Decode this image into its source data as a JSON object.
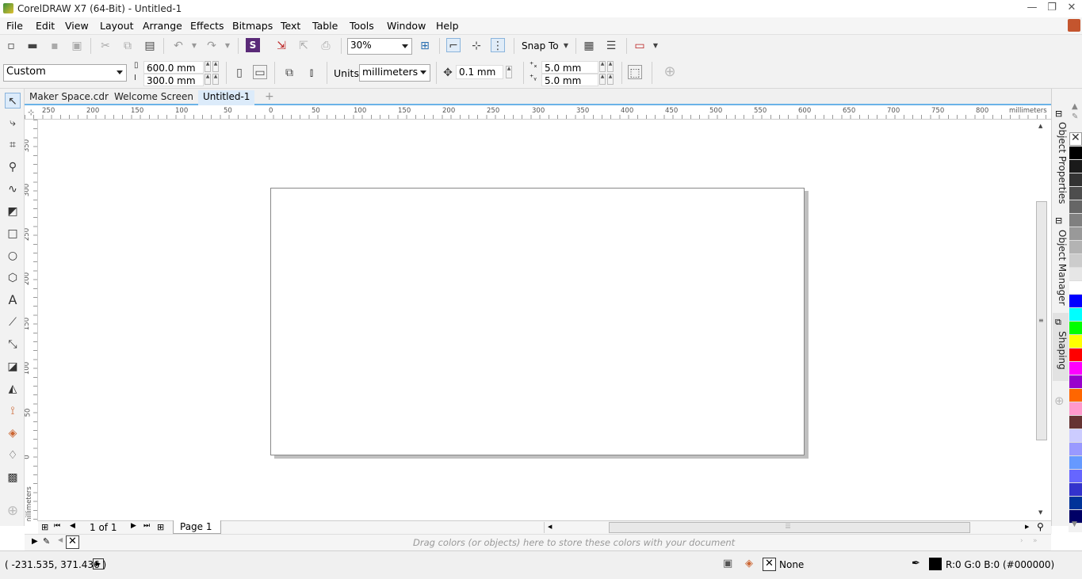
{
  "window": {
    "title": "CorelDRAW X7 (64-Bit) - Untitled-1"
  },
  "menu": [
    "File",
    "Edit",
    "View",
    "Layout",
    "Arrange",
    "Effects",
    "Bitmaps",
    "Text",
    "Table",
    "Tools",
    "Window",
    "Help"
  ],
  "toolbar": {
    "zoom": "30%",
    "snap_to": "Snap To"
  },
  "property_bar": {
    "page_preset": "Custom",
    "width": "600.0 mm",
    "height": "300.0 mm",
    "units_label": "Units:",
    "units_value": "millimeters",
    "nudge": "0.1 mm",
    "dup_x": "5.0 mm",
    "dup_y": "5.0 mm"
  },
  "doc_tabs": [
    "Maker Space.cdr",
    "Welcome Screen",
    "Untitled-1"
  ],
  "ruler": {
    "h_labels": [
      "250",
      "200",
      "150",
      "100",
      "50",
      "0",
      "50",
      "100",
      "150",
      "200",
      "250",
      "300",
      "350",
      "400",
      "450",
      "500",
      "550",
      "600",
      "650",
      "700",
      "750",
      "800"
    ],
    "h_unit": "millimeters",
    "v_labels": [
      "350",
      "300",
      "250",
      "200",
      "150",
      "100",
      "50",
      "0"
    ],
    "v_unit": "millimeters"
  },
  "page_nav": {
    "count": "1 of 1",
    "page_tab": "Page 1"
  },
  "docker_tabs": [
    "Object Properties",
    "Object Manager",
    "Shaping"
  ],
  "palette_colors": [
    "#000000",
    "#1a1a1a",
    "#333333",
    "#4d4d4d",
    "#666666",
    "#808080",
    "#999999",
    "#b3b3b3",
    "#cccccc",
    "#e6e6e6",
    "#ffffff",
    "#0000ff",
    "#00ffff",
    "#00ff00",
    "#ffff00",
    "#ff0000",
    "#ff00ff",
    "#9900cc",
    "#ff6600",
    "#ff99cc",
    "#663333",
    "#ccccff",
    "#9999ff",
    "#6699ff",
    "#6666ff",
    "#3333cc",
    "#003399",
    "#000066"
  ],
  "doc_palette": {
    "hint": "Drag colors (or objects) here to store these colors with your document"
  },
  "status": {
    "coords": "( -231.535, 371.436 )",
    "fill": "None",
    "outline": "R:0 G:0 B:0 (#000000)"
  }
}
